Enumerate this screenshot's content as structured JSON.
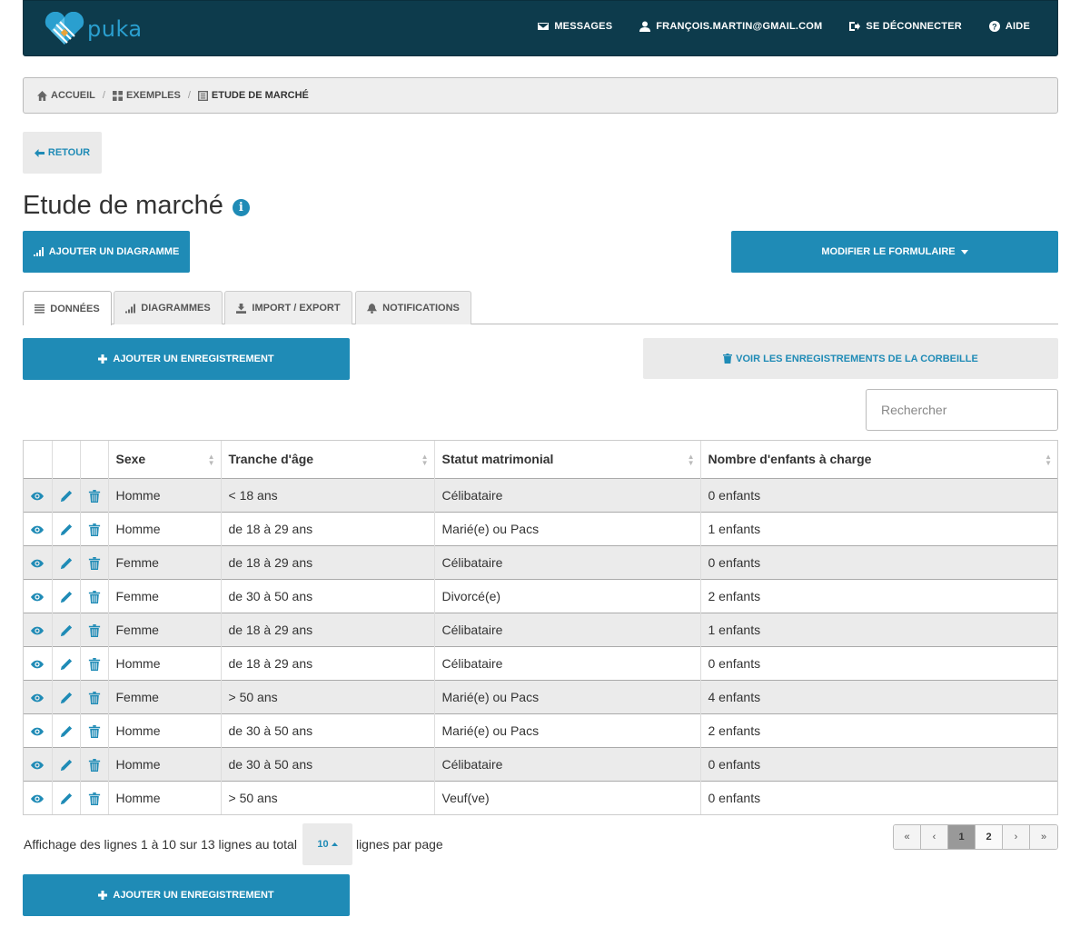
{
  "brand": {
    "name": "puka",
    "colors": {
      "accent": "#1f8bb6",
      "navbar": "#0d3b4c"
    }
  },
  "nav": {
    "messages": "MESSAGES",
    "user": "FRANÇOIS.MARTIN@GMAIL.COM",
    "logout": "SE DÉCONNECTER",
    "help": "AIDE"
  },
  "breadcrumb": {
    "home": "ACCUEIL",
    "examples": "EXEMPLES",
    "current": "ETUDE DE MARCHÉ"
  },
  "back_label": "RETOUR",
  "title": "Etude de marché",
  "add_chart_label": "AJOUTER UN DIAGRAMME",
  "edit_form_label": "MODIFIER LE FORMULAIRE",
  "tabs": [
    {
      "label": "DONNÉES",
      "icon": "list-icon",
      "active": true
    },
    {
      "label": "DIAGRAMMES",
      "icon": "chart-icon"
    },
    {
      "label": "IMPORT / EXPORT",
      "icon": "import-export-icon"
    },
    {
      "label": "NOTIFICATIONS",
      "icon": "bell-icon"
    }
  ],
  "add_record_label": "AJOUTER UN ENREGISTREMENT",
  "trash_label": "VOIR LES ENREGISTREMENTS DE LA CORBEILLE",
  "search_placeholder": "Rechercher",
  "table": {
    "columns": [
      "Sexe",
      "Tranche d'âge",
      "Statut matrimonial",
      "Nombre d'enfants à charge"
    ],
    "rows": [
      [
        "Homme",
        "< 18 ans",
        "Célibataire",
        "0 enfants"
      ],
      [
        "Homme",
        "de 18 à 29 ans",
        "Marié(e) ou Pacs",
        "1 enfants"
      ],
      [
        "Femme",
        "de 18 à 29 ans",
        "Célibataire",
        "0 enfants"
      ],
      [
        "Femme",
        "de 30 à 50 ans",
        "Divorcé(e)",
        "2 enfants"
      ],
      [
        "Femme",
        "de 18 à 29 ans",
        "Célibataire",
        "1 enfants"
      ],
      [
        "Homme",
        "de 18 à 29 ans",
        "Célibataire",
        "0 enfants"
      ],
      [
        "Femme",
        "> 50 ans",
        "Marié(e) ou Pacs",
        "4 enfants"
      ],
      [
        "Homme",
        "de 30 à 50 ans",
        "Marié(e) ou Pacs",
        "2 enfants"
      ],
      [
        "Homme",
        "de 30 à 50 ans",
        "Célibataire",
        "0 enfants"
      ],
      [
        "Homme",
        "> 50 ans",
        "Veuf(ve)",
        "0 enfants"
      ]
    ]
  },
  "footer": {
    "info": "Affichage des lignes 1 à 10 sur 13 lignes au total",
    "page_size": "10",
    "per_page": "lignes par page"
  },
  "pagination": [
    "«",
    "‹",
    "1",
    "2",
    "›",
    "»"
  ]
}
